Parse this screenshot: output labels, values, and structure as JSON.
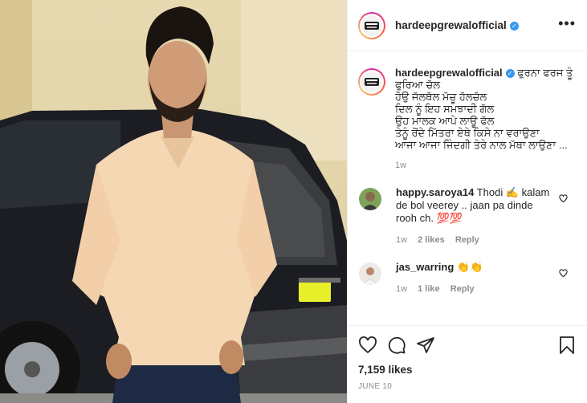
{
  "post": {
    "username": "hardeepgrewalofficial",
    "verified": true,
    "more_icon": "more-horizontal-icon",
    "caption_user": "hardeepgrewalofficial",
    "caption": "ਫੁਰਨਾ ਫਰਜ ਤੂੰ\nਫੁਰਿਆ ਚੱਲ\nਹੋਉ ਜੱਲਥੱਲ ਮੱਚੂ ਹੱਲਚੱਲ\nਦਿਲ ਨੂੰ ਇਹ ਸਮਝਾਦੀ ਗੱਲ\nਉਹ ਮਾਲਕ ਆਪੇ ਲਾਊ ਫੱਲ\nਤੇਨੂੰ ਰੋਂਦੇ ਮਿੱਤਰਾ ਏਥੇ ਕਿਸੇ ਨਾ ਵਰਾਉਣਾ\nਆਜਾ ਆਜਾ ਜਿੰਦਗੀ ਤੇਰੇ ਨਾਲ ਮੱਥਾ ਲਾਉਣਾ ...",
    "caption_time": "1w",
    "likes": "7,159 likes",
    "date": "JUNE 10"
  },
  "comments": [
    {
      "user": "happy.saroya14",
      "text": "Thodi ✍️ kalam de bol veerey .. jaan pa dinde rooh ch. 💯💯",
      "time": "1w",
      "likes": "2 likes",
      "reply": "Reply"
    },
    {
      "user": "jas_warring",
      "text": "👏👏",
      "time": "1w",
      "likes": "1 like",
      "reply": "Reply"
    }
  ],
  "icons": {
    "like": "heart-icon",
    "comment": "comment-icon",
    "share": "share-icon",
    "save": "bookmark-icon"
  },
  "colors": {
    "verified": "#3897f0",
    "muted": "#8e8e8e",
    "text": "#262626",
    "shirt": "#f6d7b4"
  }
}
